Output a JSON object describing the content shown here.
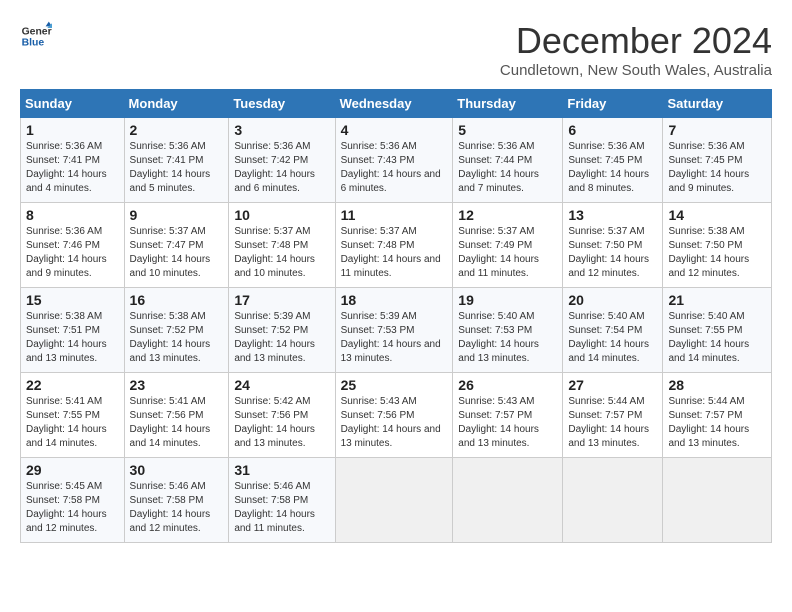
{
  "logo": {
    "line1": "General",
    "line2": "Blue"
  },
  "title": "December 2024",
  "subtitle": "Cundletown, New South Wales, Australia",
  "days_of_week": [
    "Sunday",
    "Monday",
    "Tuesday",
    "Wednesday",
    "Thursday",
    "Friday",
    "Saturday"
  ],
  "weeks": [
    [
      {
        "day": "1",
        "sunrise": "5:36 AM",
        "sunset": "7:41 PM",
        "daylight": "14 hours and 4 minutes."
      },
      {
        "day": "2",
        "sunrise": "5:36 AM",
        "sunset": "7:41 PM",
        "daylight": "14 hours and 5 minutes."
      },
      {
        "day": "3",
        "sunrise": "5:36 AM",
        "sunset": "7:42 PM",
        "daylight": "14 hours and 6 minutes."
      },
      {
        "day": "4",
        "sunrise": "5:36 AM",
        "sunset": "7:43 PM",
        "daylight": "14 hours and 6 minutes."
      },
      {
        "day": "5",
        "sunrise": "5:36 AM",
        "sunset": "7:44 PM",
        "daylight": "14 hours and 7 minutes."
      },
      {
        "day": "6",
        "sunrise": "5:36 AM",
        "sunset": "7:45 PM",
        "daylight": "14 hours and 8 minutes."
      },
      {
        "day": "7",
        "sunrise": "5:36 AM",
        "sunset": "7:45 PM",
        "daylight": "14 hours and 9 minutes."
      }
    ],
    [
      {
        "day": "8",
        "sunrise": "5:36 AM",
        "sunset": "7:46 PM",
        "daylight": "14 hours and 9 minutes."
      },
      {
        "day": "9",
        "sunrise": "5:37 AM",
        "sunset": "7:47 PM",
        "daylight": "14 hours and 10 minutes."
      },
      {
        "day": "10",
        "sunrise": "5:37 AM",
        "sunset": "7:48 PM",
        "daylight": "14 hours and 10 minutes."
      },
      {
        "day": "11",
        "sunrise": "5:37 AM",
        "sunset": "7:48 PM",
        "daylight": "14 hours and 11 minutes."
      },
      {
        "day": "12",
        "sunrise": "5:37 AM",
        "sunset": "7:49 PM",
        "daylight": "14 hours and 11 minutes."
      },
      {
        "day": "13",
        "sunrise": "5:37 AM",
        "sunset": "7:50 PM",
        "daylight": "14 hours and 12 minutes."
      },
      {
        "day": "14",
        "sunrise": "5:38 AM",
        "sunset": "7:50 PM",
        "daylight": "14 hours and 12 minutes."
      }
    ],
    [
      {
        "day": "15",
        "sunrise": "5:38 AM",
        "sunset": "7:51 PM",
        "daylight": "14 hours and 13 minutes."
      },
      {
        "day": "16",
        "sunrise": "5:38 AM",
        "sunset": "7:52 PM",
        "daylight": "14 hours and 13 minutes."
      },
      {
        "day": "17",
        "sunrise": "5:39 AM",
        "sunset": "7:52 PM",
        "daylight": "14 hours and 13 minutes."
      },
      {
        "day": "18",
        "sunrise": "5:39 AM",
        "sunset": "7:53 PM",
        "daylight": "14 hours and 13 minutes."
      },
      {
        "day": "19",
        "sunrise": "5:40 AM",
        "sunset": "7:53 PM",
        "daylight": "14 hours and 13 minutes."
      },
      {
        "day": "20",
        "sunrise": "5:40 AM",
        "sunset": "7:54 PM",
        "daylight": "14 hours and 14 minutes."
      },
      {
        "day": "21",
        "sunrise": "5:40 AM",
        "sunset": "7:55 PM",
        "daylight": "14 hours and 14 minutes."
      }
    ],
    [
      {
        "day": "22",
        "sunrise": "5:41 AM",
        "sunset": "7:55 PM",
        "daylight": "14 hours and 14 minutes."
      },
      {
        "day": "23",
        "sunrise": "5:41 AM",
        "sunset": "7:56 PM",
        "daylight": "14 hours and 14 minutes."
      },
      {
        "day": "24",
        "sunrise": "5:42 AM",
        "sunset": "7:56 PM",
        "daylight": "14 hours and 13 minutes."
      },
      {
        "day": "25",
        "sunrise": "5:43 AM",
        "sunset": "7:56 PM",
        "daylight": "14 hours and 13 minutes."
      },
      {
        "day": "26",
        "sunrise": "5:43 AM",
        "sunset": "7:57 PM",
        "daylight": "14 hours and 13 minutes."
      },
      {
        "day": "27",
        "sunrise": "5:44 AM",
        "sunset": "7:57 PM",
        "daylight": "14 hours and 13 minutes."
      },
      {
        "day": "28",
        "sunrise": "5:44 AM",
        "sunset": "7:57 PM",
        "daylight": "14 hours and 13 minutes."
      }
    ],
    [
      {
        "day": "29",
        "sunrise": "5:45 AM",
        "sunset": "7:58 PM",
        "daylight": "14 hours and 12 minutes."
      },
      {
        "day": "30",
        "sunrise": "5:46 AM",
        "sunset": "7:58 PM",
        "daylight": "14 hours and 12 minutes."
      },
      {
        "day": "31",
        "sunrise": "5:46 AM",
        "sunset": "7:58 PM",
        "daylight": "14 hours and 11 minutes."
      },
      null,
      null,
      null,
      null
    ]
  ],
  "labels": {
    "sunrise": "Sunrise:",
    "sunset": "Sunset:",
    "daylight": "Daylight:"
  }
}
